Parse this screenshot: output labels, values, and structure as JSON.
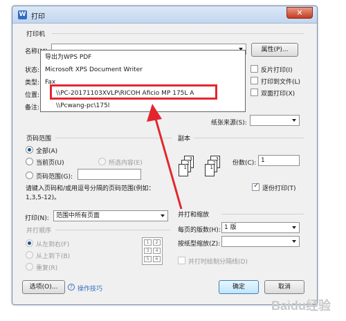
{
  "window": {
    "title": "打印",
    "close_icon": "✕"
  },
  "printer": {
    "group_title": "打印机",
    "name_label": "名称(M):",
    "properties_button": "属性(P)...",
    "status_label": "状态:",
    "type_label": "类型:",
    "location_label": "位置:",
    "comment_label": "备注:",
    "dropdown_items": [
      "导出为WPS PDF",
      "Microsoft XPS Document Writer",
      "Fax",
      "\\\\PC-20171103XVLP\\RICOH Aficio MP 175L A",
      "\\\\Pcwang-pc\\175l"
    ],
    "options": {
      "reverse_print": "反片打印(I)",
      "print_to_file": "打印到文件(L)",
      "duplex": "双面打印(X)"
    },
    "paper_source_label": "纸张来源(S):"
  },
  "page_range": {
    "group_title": "页码范围",
    "all": "全部(A)",
    "current": "当前页(U)",
    "selection": "所选内容(E)",
    "pages": "页码范围(G):",
    "hint": "请键入页码和/或用逗号分隔的页码范围(例如：1,3,5-12)。"
  },
  "copies": {
    "group_title": "副本",
    "count_label": "份数(C):",
    "count_value": "1",
    "collate": "逐份打印(T)"
  },
  "print_what": {
    "label": "打印(N):",
    "value": "范围中所有页面"
  },
  "order": {
    "group_title": "并打顺序",
    "left_right": "从左到右(F)",
    "top_bottom": "从上到下(B)",
    "repeat": "重复(R)"
  },
  "zoom": {
    "group_title": "并打和缩放",
    "pages_per_sheet_label": "每页的版数(H):",
    "pages_per_sheet_value": "1 版",
    "scale_label": "按纸型缩放(Z):",
    "draw_lines": "并打时绘制分隔线(D)"
  },
  "footer": {
    "options_button": "选项(O)...",
    "tips_link": "操作技巧",
    "ok_button": "确定",
    "cancel_button": "取消"
  },
  "watermark": "Baidu经验"
}
